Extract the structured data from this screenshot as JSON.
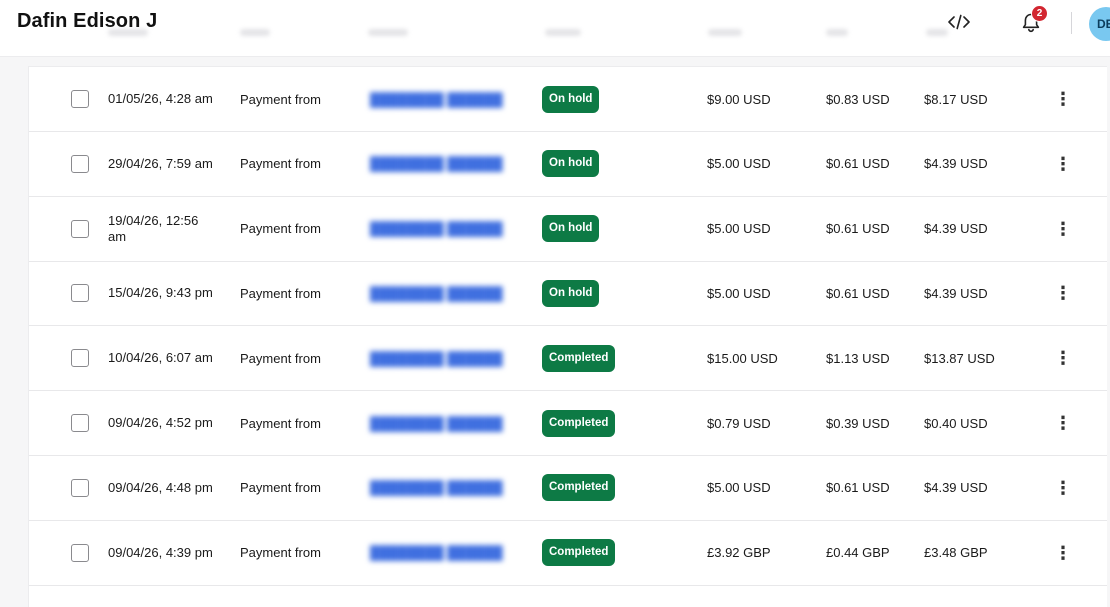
{
  "header": {
    "title": "Dafin Edison J",
    "notification_count": "2",
    "avatar_initials": "DE"
  },
  "colors": {
    "on_hold": "#0d7a45",
    "completed": "#0d7a45",
    "link": "#3f6fe0",
    "badge": "#d22630"
  },
  "transactions": [
    {
      "date": "01/05/26, 4:28 am",
      "description": "Payment from",
      "status": "On hold",
      "amount": "$9.00 USD",
      "fee": "$0.83 USD",
      "net": "$8.17 USD"
    },
    {
      "date": "29/04/26, 7:59 am",
      "description": "Payment from",
      "status": "On hold",
      "amount": "$5.00 USD",
      "fee": "$0.61 USD",
      "net": "$4.39 USD"
    },
    {
      "date": "19/04/26, 12:56 am",
      "description": "Payment from",
      "status": "On hold",
      "amount": "$5.00 USD",
      "fee": "$0.61 USD",
      "net": "$4.39 USD"
    },
    {
      "date": "15/04/26, 9:43 pm",
      "description": "Payment from",
      "status": "On hold",
      "amount": "$5.00 USD",
      "fee": "$0.61 USD",
      "net": "$4.39 USD"
    },
    {
      "date": "10/04/26, 6:07 am",
      "description": "Payment from",
      "status": "Completed",
      "amount": "$15.00 USD",
      "fee": "$1.13 USD",
      "net": "$13.87 USD"
    },
    {
      "date": "09/04/26, 4:52 pm",
      "description": "Payment from",
      "status": "Completed",
      "amount": "$0.79 USD",
      "fee": "$0.39 USD",
      "net": "$0.40 USD"
    },
    {
      "date": "09/04/26, 4:48 pm",
      "description": "Payment from",
      "status": "Completed",
      "amount": "$5.00 USD",
      "fee": "$0.61 USD",
      "net": "$4.39 USD"
    },
    {
      "date": "09/04/26, 4:39 pm",
      "description": "Payment from",
      "status": "Completed",
      "amount": "£3.92 GBP",
      "fee": "£0.44 GBP",
      "net": "£3.48 GBP"
    }
  ]
}
